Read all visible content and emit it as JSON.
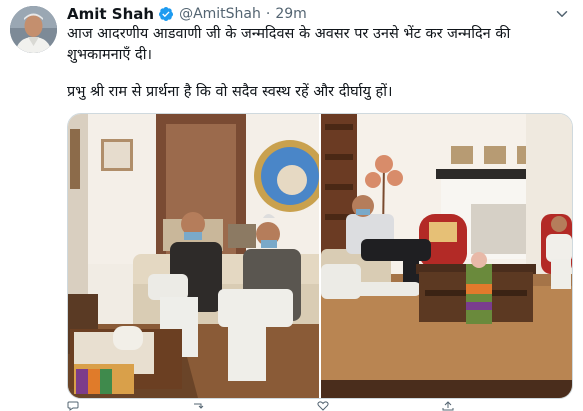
{
  "author": {
    "name": "Amit Shah",
    "handle": "@AmitShah",
    "separator": "·",
    "time": "29m"
  },
  "tweet": {
    "paragraph1": "आज आदरणीय आडवाणी जी के जन्मदिवस के अवसर पर उनसे भेंट कर जन्मदिन की शुभकामनाएँ दी।",
    "paragraph2": "प्रभु श्री राम से प्रार्थना है कि वो सदैव स्वस्थ रहें और दीर्घायु हों।"
  },
  "icons": {
    "verified": "verified-badge-icon",
    "more": "chevron-down-icon",
    "reply": "reply-icon",
    "retweet": "retweet-icon",
    "like": "like-icon",
    "share": "share-icon"
  },
  "colors": {
    "verified": "#1d9bf0",
    "text": "#0f1419",
    "secondary": "#536471"
  }
}
